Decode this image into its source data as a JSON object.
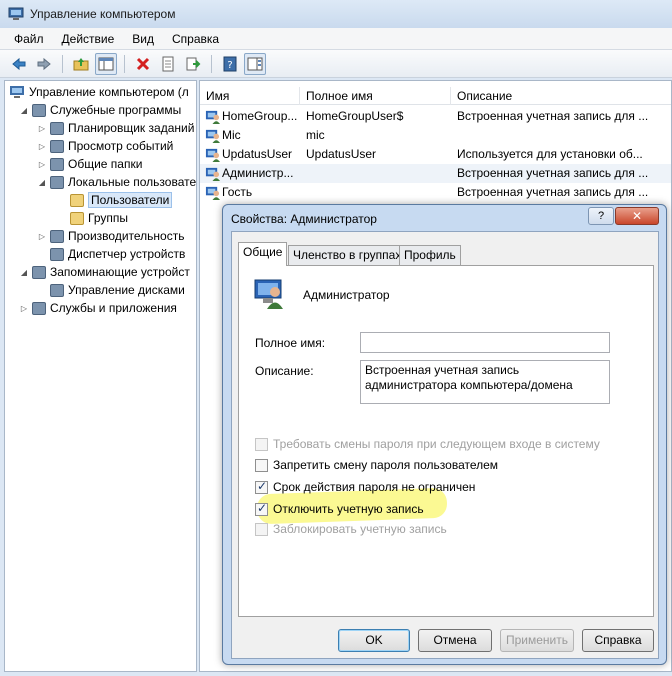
{
  "window": {
    "title": "Управление компьютером"
  },
  "menu": [
    "Файл",
    "Действие",
    "Вид",
    "Справка"
  ],
  "tree": {
    "root": "Управление компьютером (л",
    "items": [
      {
        "label": "Служебные программы",
        "level": 1,
        "expander": "open"
      },
      {
        "label": "Планировщик заданий",
        "level": 2,
        "expander": "closed"
      },
      {
        "label": "Просмотр событий",
        "level": 2,
        "expander": "closed"
      },
      {
        "label": "Общие папки",
        "level": 2,
        "expander": "closed"
      },
      {
        "label": "Локальные пользовате",
        "level": 2,
        "expander": "open"
      },
      {
        "label": "Пользователи",
        "level": 3,
        "expander": "none",
        "selected": true
      },
      {
        "label": "Группы",
        "level": 3,
        "expander": "none"
      },
      {
        "label": "Производительность",
        "level": 2,
        "expander": "closed"
      },
      {
        "label": "Диспетчер устройств",
        "level": 2,
        "expander": "none"
      },
      {
        "label": "Запоминающие устройст",
        "level": 1,
        "expander": "open"
      },
      {
        "label": "Управление дисками",
        "level": 2,
        "expander": "none"
      },
      {
        "label": "Службы и приложения",
        "level": 1,
        "expander": "closed"
      }
    ]
  },
  "list": {
    "columns": [
      "Имя",
      "Полное имя",
      "Описание"
    ],
    "rows": [
      {
        "name": "HomeGroup...",
        "fullname": "HomeGroupUser$",
        "desc": "Встроенная учетная запись для ..."
      },
      {
        "name": "Mic",
        "fullname": "mic",
        "desc": ""
      },
      {
        "name": "UpdatusUser",
        "fullname": "UpdatusUser",
        "desc": "Используется для установки об..."
      },
      {
        "name": "Администр...",
        "fullname": "",
        "desc": "Встроенная учетная запись для ..."
      },
      {
        "name": "Гость",
        "fullname": "",
        "desc": "Встроенная учетная запись для ..."
      }
    ]
  },
  "dialog": {
    "title": "Свойства: Администратор",
    "help": "?",
    "close": "✕",
    "tabs": [
      "Общие",
      "Членство в группах",
      "Профиль"
    ],
    "username": "Администратор",
    "fullname_label": "Полное имя:",
    "fullname_value": "",
    "desc_label": "Описание:",
    "desc_value": "Встроенная учетная запись администратора компьютера/домена",
    "checks": [
      {
        "label": "Требовать смены пароля при следующем входе в систему",
        "checked": false,
        "disabled": true
      },
      {
        "label": "Запретить смену пароля пользователем",
        "checked": false,
        "disabled": false
      },
      {
        "label": "Срок действия пароля не ограничен",
        "checked": true,
        "disabled": false
      },
      {
        "label": "Отключить учетную запись",
        "checked": true,
        "disabled": false
      },
      {
        "label": "Заблокировать учетную запись",
        "checked": false,
        "disabled": true
      }
    ],
    "buttons": {
      "ok": "OK",
      "cancel": "Отмена",
      "apply": "Применить",
      "help": "Справка"
    }
  },
  "colors": {
    "highlight": "#f8f43a",
    "selection": "#d9e8f9"
  }
}
